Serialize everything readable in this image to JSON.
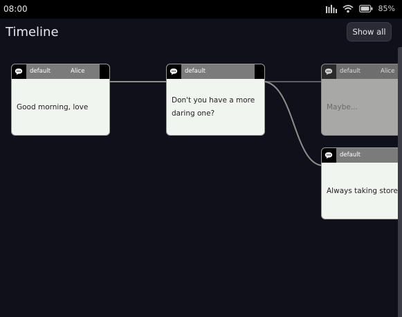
{
  "status_bar": {
    "time": "08:00",
    "battery": "85%",
    "icons": [
      "signal-icon",
      "wifi-icon",
      "battery-icon"
    ]
  },
  "header": {
    "title": "Timeline",
    "show_all_label": "Show all"
  },
  "nodes": [
    {
      "channel": "default",
      "speaker": "Alice",
      "text": "Good morning, love",
      "icon": "speech-bubble-icon"
    },
    {
      "channel": "default",
      "speaker": "",
      "text": "Don't you have a more daring one?",
      "icon": "speech-bubble-icon"
    },
    {
      "channel": "default",
      "speaker": "Alice",
      "text": "Maybe...",
      "icon": "speech-bubble-icon",
      "state": "dimmed"
    },
    {
      "channel": "default",
      "speaker": "",
      "text": "Always taking store pics?",
      "icon": "speech-bubble-icon"
    }
  ],
  "colors": {
    "background": "#0f1019",
    "node_body": "#f1f5ef",
    "node_header": "#7b7b7b",
    "connector": "#8e8e8e"
  }
}
